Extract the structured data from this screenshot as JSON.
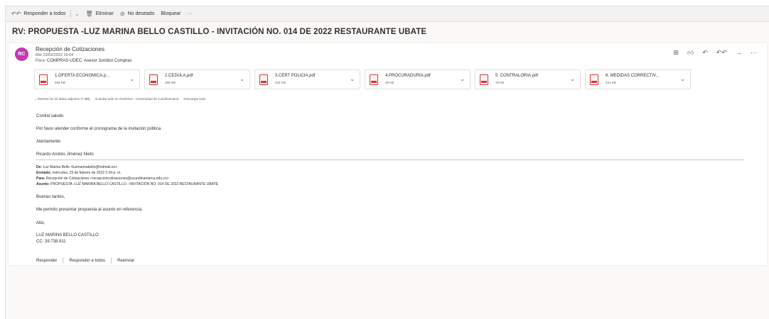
{
  "toolbar": {
    "reply_all": "Responder a todos",
    "delete": "Eliminar",
    "junk": "No deseado",
    "block": "Bloquear",
    "more": "···"
  },
  "subject": "RV: PROPUESTA -LUZ MARINA BELLO CASTILLO - INVITACIÓN NO. 014 DE 2022 RESTAURANTE UBATE",
  "message": {
    "avatar_initials": "RC",
    "avatar_color": "#c239b3",
    "sender": "Recepción de Cotizaciones",
    "date": "Mié 23/02/2022 15:04",
    "to_label": "Para:",
    "to": "COMPRAS UDEC: Asesor Jurídico Compras"
  },
  "attachments": [
    {
      "name": "1.OFERTA ECONOMICA.p...",
      "size": "466 KB"
    },
    {
      "name": "2.CEDULA.pdf",
      "size": "295 KB"
    },
    {
      "name": "3.CERT POLICIA.pdf",
      "size": "222 KB"
    },
    {
      "name": "4.PROCURADURIA.pdf",
      "size": "29 KB"
    },
    {
      "name": "5. CONTRALORIA.pdf",
      "size": "78 KB"
    },
    {
      "name": "6. MEDIDAS CORRECTIV...",
      "size": "241 KB"
    }
  ],
  "attachment_links": {
    "show_all": "Mostrar los 22 datos adjuntos (7 MB)",
    "save_onedrive": "Guardar todo en OneDrive - Universidad de Cundinamarca",
    "download_all": "Descargar todo"
  },
  "body": {
    "greeting": "Cordial saludo",
    "line1": "Por favor atender conforme el cronograma de la invitación pública",
    "closing": "Atentamente",
    "signature": "Ricardo Andrés Jiménez Nieto"
  },
  "forwarded": {
    "from_label": "De:",
    "from": "Luz Marina Bello <luzmarinabello@hotmail.es>",
    "sent_label": "Enviado:",
    "sent": "miércoles, 23 de febrero de 2022 2:34 p. m.",
    "to_label": "Para:",
    "to": "Recepción de Cotizaciones <recepcioncotizaciones@ucundinamarca.edu.co>",
    "subject_label": "Asunto:",
    "subject": "PROPUESTA -LUZ MARINA BELLO CASTILLO - INVITACIÓN NO. 014 DE 2022 RESTAURANTE UBATE",
    "greeting": "Buenas tardes,",
    "line1": "Me permito presentar propuesta al asunto en referencia.",
    "closing": "Atte,",
    "name": "LUZ MARINA BELLO CASTILLO",
    "cc": "CC: 39.738.911"
  },
  "replybar": {
    "reply": "Responder",
    "reply_all": "Responder a todos",
    "forward": "Reenviar"
  }
}
